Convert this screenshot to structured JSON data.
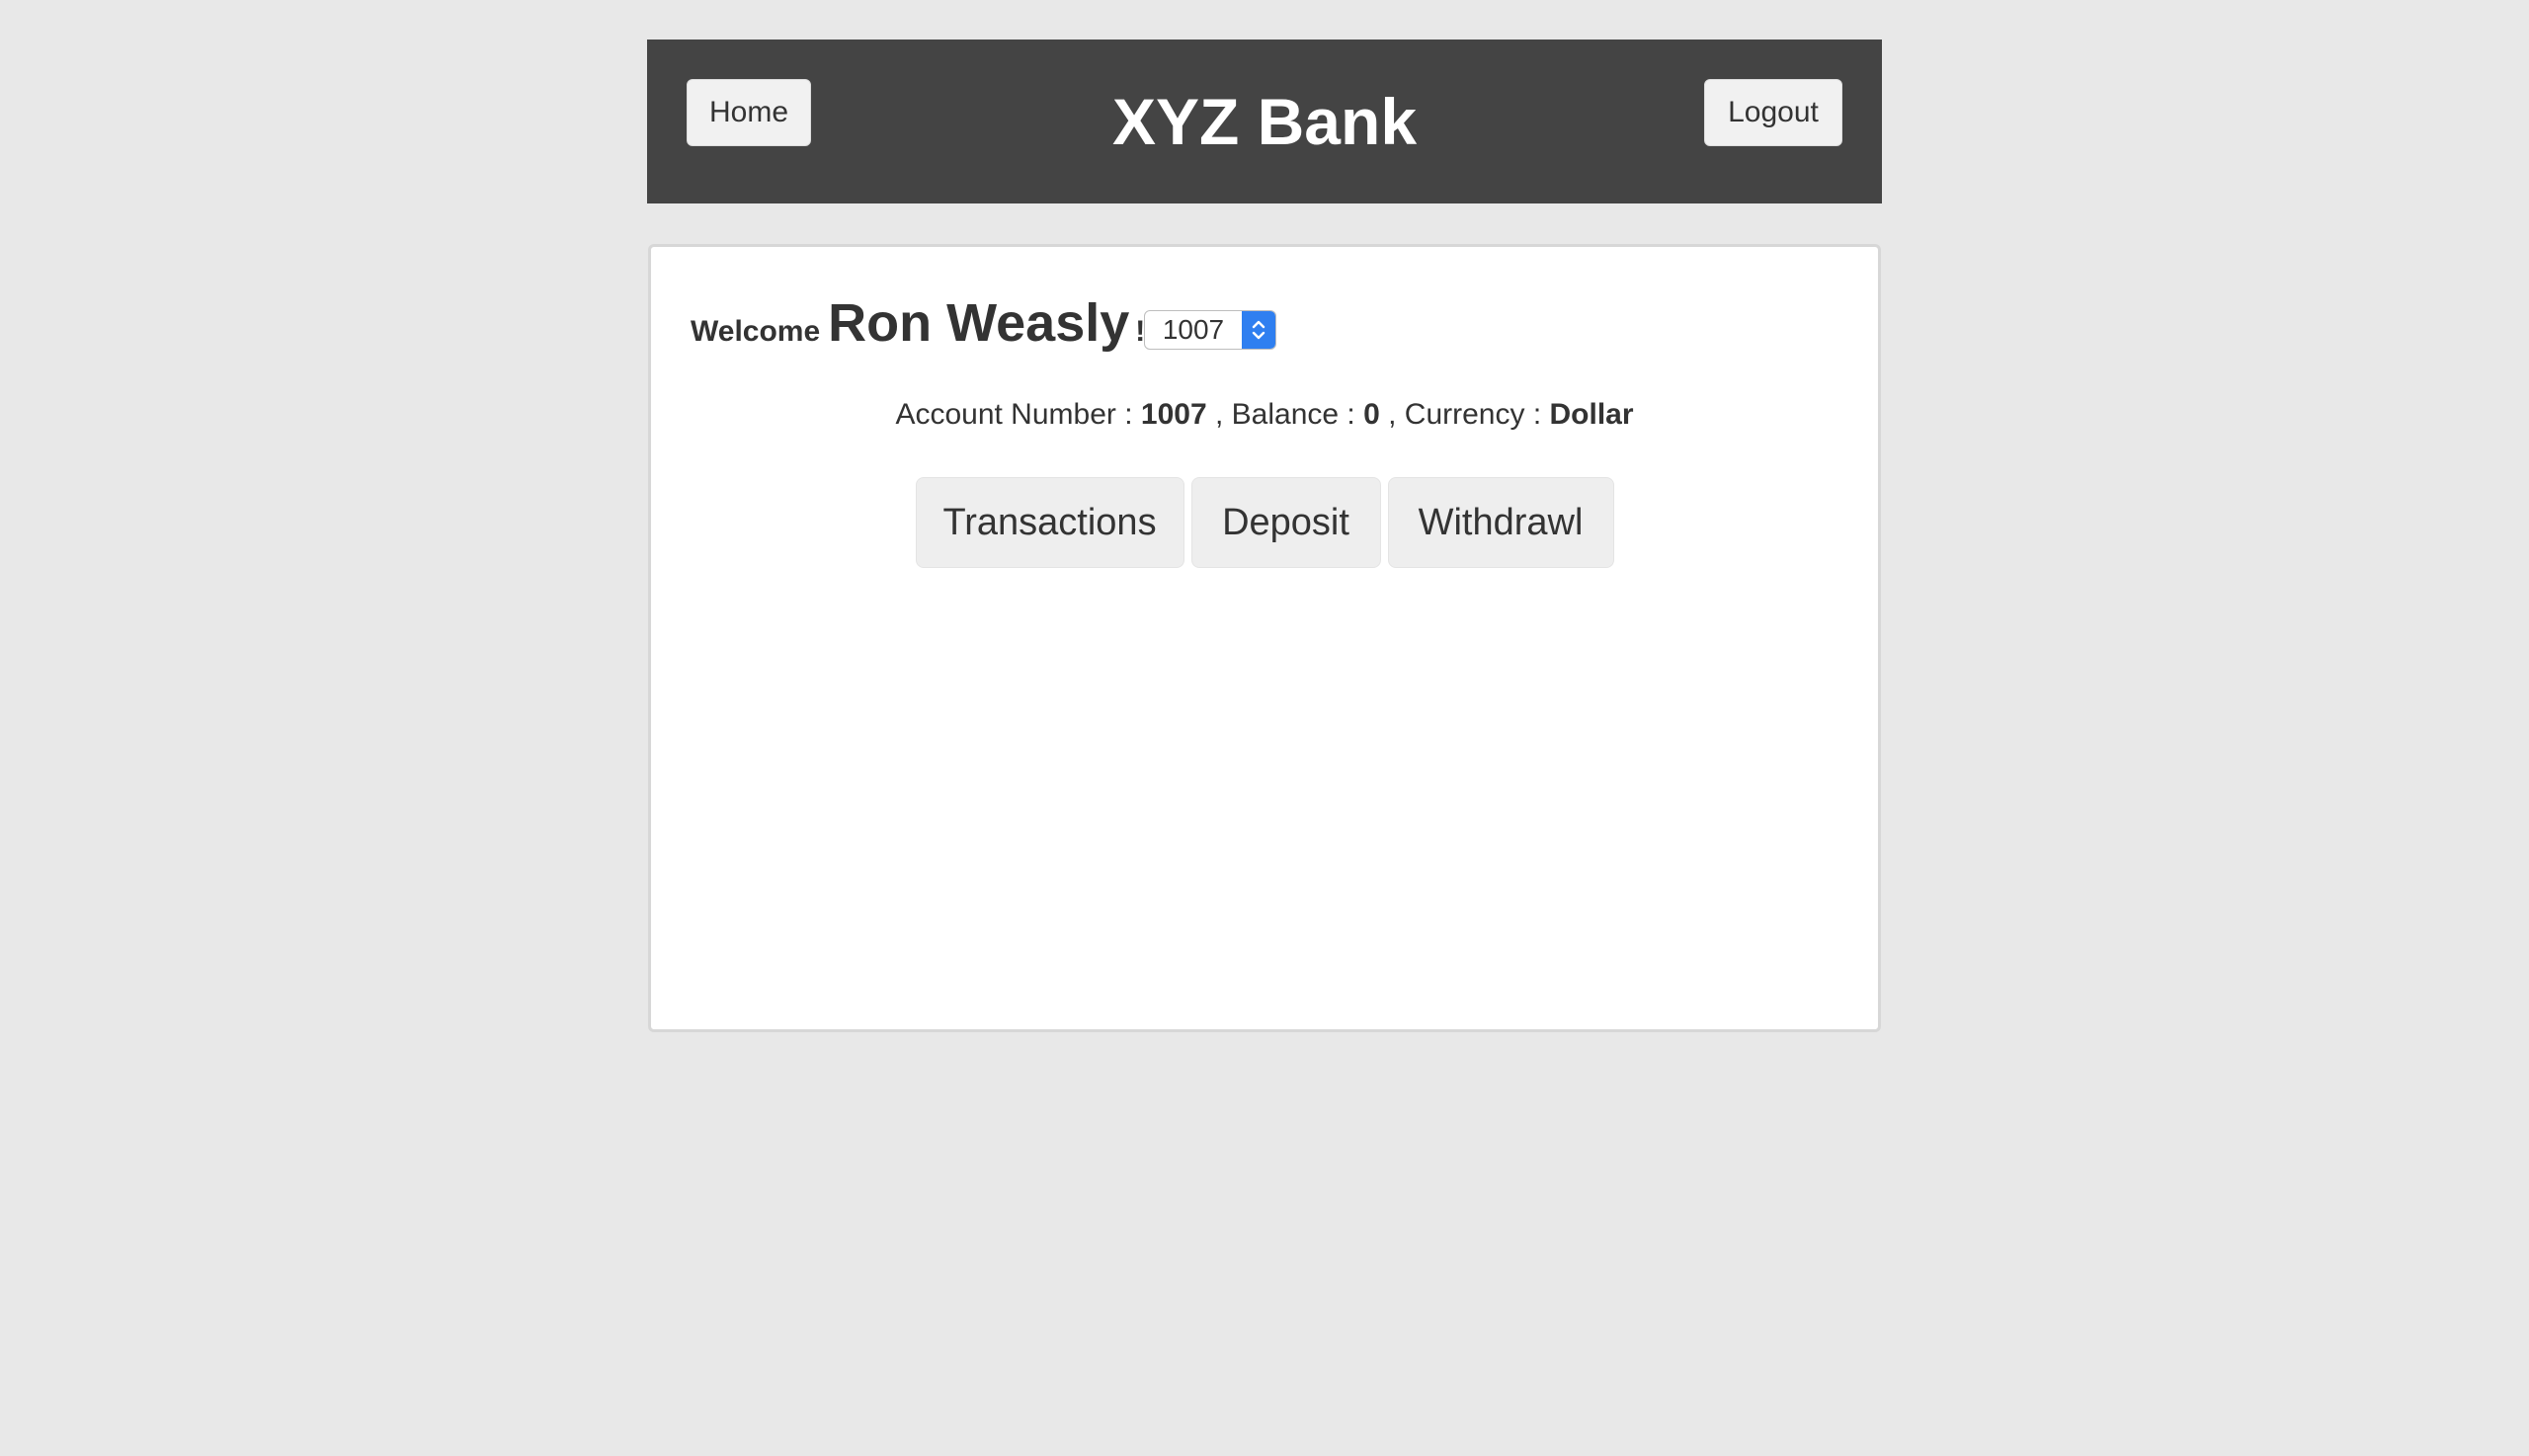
{
  "header": {
    "title": "XYZ Bank",
    "home_label": "Home",
    "logout_label": "Logout"
  },
  "welcome": {
    "prefix": "Welcome",
    "user_name": "Ron Weasly",
    "suffix": "!!"
  },
  "account_select": {
    "selected": "1007"
  },
  "account_info": {
    "number_label": "Account Number :",
    "number": "1007",
    "balance_label": ", Balance :",
    "balance": "0",
    "currency_label": ", Currency :",
    "currency": "Dollar"
  },
  "tabs": [
    {
      "label": "Transactions"
    },
    {
      "label": "Deposit"
    },
    {
      "label": "Withdrawl"
    }
  ],
  "colors": {
    "page_background": "#e8e8e8",
    "header_background": "#444444",
    "select_accent": "#2f7ff0"
  },
  "icons": {
    "select_arrows": "up-down-chevron-icon"
  }
}
